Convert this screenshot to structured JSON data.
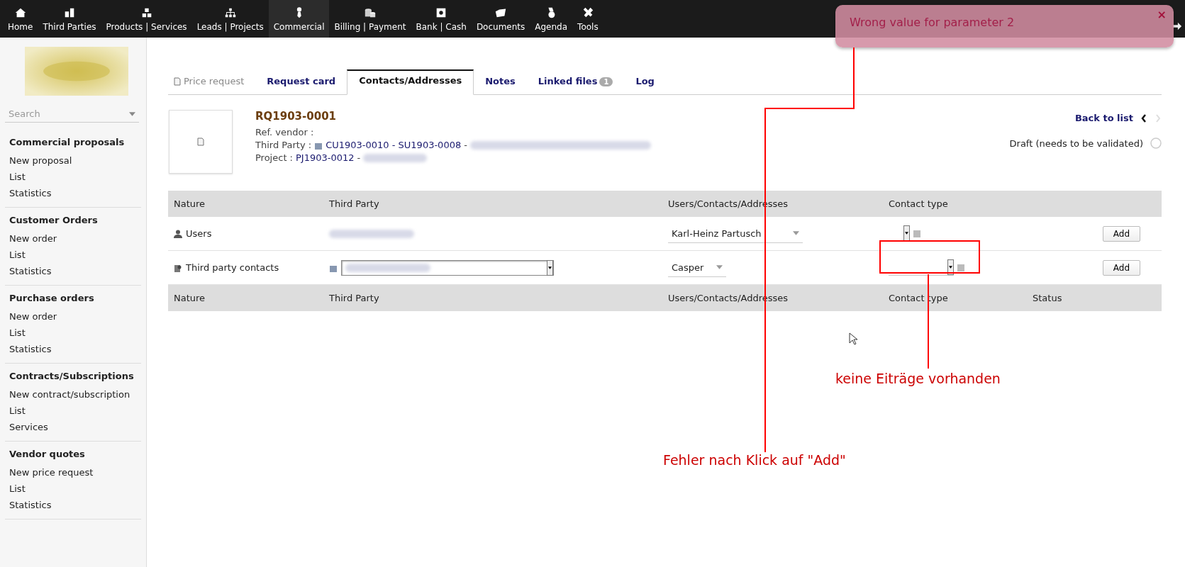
{
  "top_menu": [
    {
      "label": "Home",
      "selected": false
    },
    {
      "label": "Third Parties",
      "selected": false
    },
    {
      "label": "Products | Services",
      "selected": false
    },
    {
      "label": "Leads | Projects",
      "selected": false
    },
    {
      "label": "Commercial",
      "selected": true
    },
    {
      "label": "Billing | Payment",
      "selected": false
    },
    {
      "label": "Bank | Cash",
      "selected": false
    },
    {
      "label": "Documents",
      "selected": false
    },
    {
      "label": "Agenda",
      "selected": false
    },
    {
      "label": "Tools",
      "selected": false
    }
  ],
  "toast": {
    "message": "Wrong value for parameter 2",
    "close": "×"
  },
  "sidebar": {
    "search": {
      "placeholder": "Search"
    },
    "sections": [
      {
        "title": "Commercial proposals",
        "items": [
          "New proposal",
          "List",
          "Statistics"
        ]
      },
      {
        "title": "Customer Orders",
        "items": [
          "New order",
          "List",
          "Statistics"
        ]
      },
      {
        "title": "Purchase orders",
        "items": [
          "New order",
          "List",
          "Statistics"
        ]
      },
      {
        "title": "Contracts/Subscriptions",
        "items": [
          "New contract/subscription",
          "List",
          "Services"
        ]
      },
      {
        "title": "Vendor quotes",
        "items": [
          "New price request",
          "List",
          "Statistics"
        ]
      }
    ]
  },
  "page_title": "Price request",
  "tabs": [
    {
      "label": "Request card",
      "selected": false
    },
    {
      "label": "Contacts/Addresses",
      "selected": true
    },
    {
      "label": "Notes",
      "selected": false
    },
    {
      "label": "Linked files",
      "selected": false,
      "badge": "1"
    },
    {
      "label": "Log",
      "selected": false
    }
  ],
  "record": {
    "ref": "RQ1903-0001",
    "ref_vendor": "Ref. vendor :",
    "third_party_label": "Third Party :",
    "third_party_link": "CU1903-0010 - SU1903-0008",
    "sep1": "-",
    "project_label": "Project :",
    "project_link": "PJ1903-0012",
    "sep2": "-",
    "back_to_list": "Back to list",
    "status": "Draft (needs to be validated)"
  },
  "table": {
    "columns": [
      "Nature",
      "Third Party",
      "Users/Contacts/Addresses",
      "Contact type"
    ],
    "rows": [
      {
        "nature": "Users",
        "kind": "users",
        "contact": "Karl-Heinz Partusch",
        "button": "Add"
      },
      {
        "nature": "Third party contacts",
        "kind": "contacts",
        "contact": "Casper",
        "button": "Add"
      }
    ],
    "footer_columns": [
      "Nature",
      "Third Party",
      "Users/Contacts/Addresses",
      "Contact type",
      "Status"
    ]
  },
  "annotations": {
    "error_note": "Fehler nach Klick auf \"Add\"",
    "empty_note": "keine Eiträge vorhanden"
  }
}
